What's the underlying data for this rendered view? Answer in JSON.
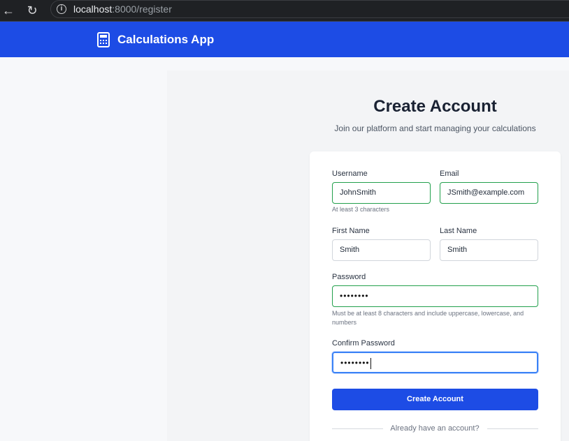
{
  "browser": {
    "url_host": "localhost",
    "url_path": ":8000/register"
  },
  "header": {
    "app_title": "Calculations App",
    "logo_icon": "calculator-icon",
    "bg_color": "#1d4ce5"
  },
  "page": {
    "title": "Create Account",
    "subtitle": "Join our platform and start managing your calculations"
  },
  "form": {
    "username": {
      "label": "Username",
      "value": "JohnSmith",
      "hint": "At least 3 characters"
    },
    "email": {
      "label": "Email",
      "value": "JSmith@example.com"
    },
    "first_name": {
      "label": "First Name",
      "value": "Smith"
    },
    "last_name": {
      "label": "Last Name",
      "value": "Smith"
    },
    "password": {
      "label": "Password",
      "value": "••••••••",
      "hint": "Must be at least 8 characters and include uppercase, lowercase, and numbers"
    },
    "confirm_password": {
      "label": "Confirm Password",
      "value": "••••••••"
    },
    "submit_label": "Create Account",
    "login_prompt": "Already have an account?"
  },
  "colors": {
    "valid_border": "#22a04c",
    "focus_border": "#3b82f6",
    "primary": "#1d4ce5"
  }
}
